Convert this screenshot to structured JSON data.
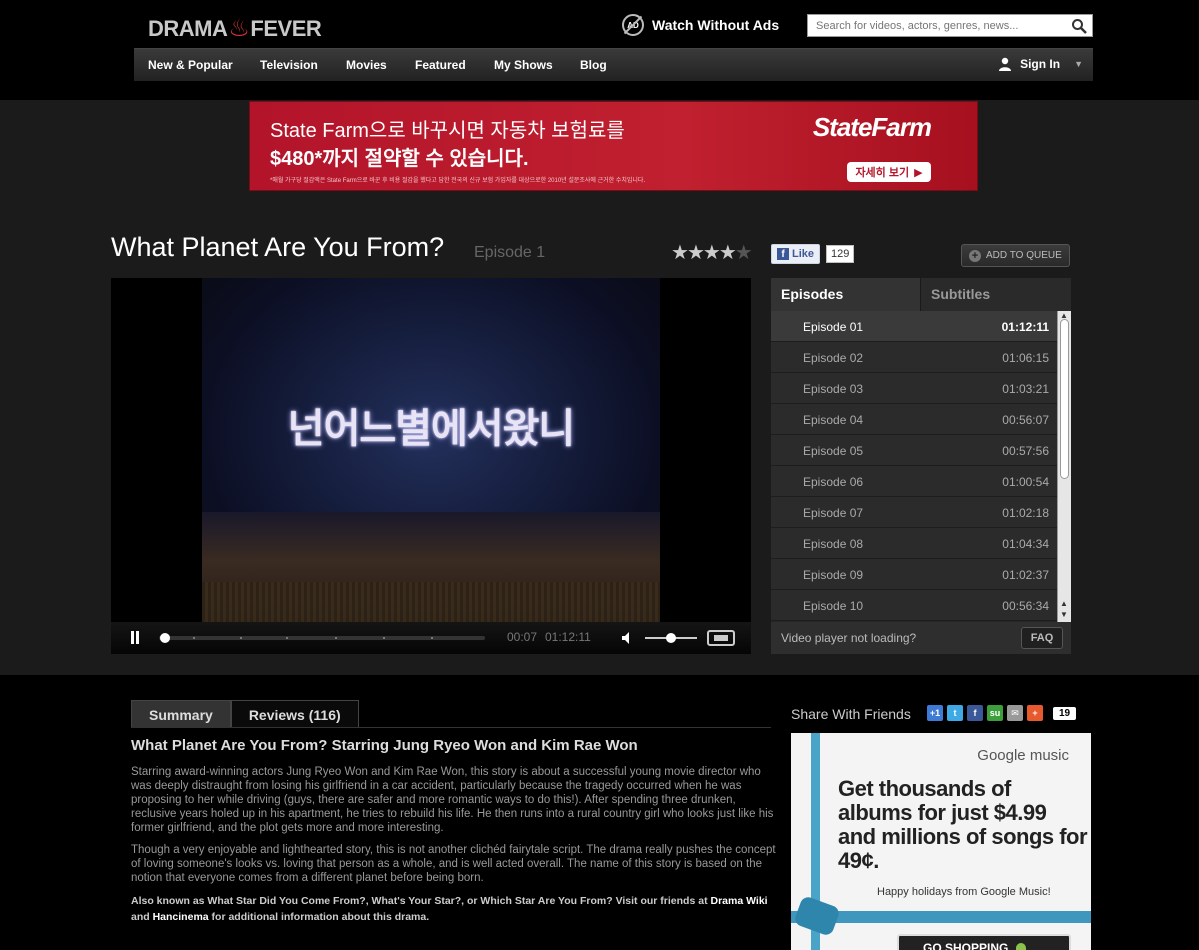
{
  "header": {
    "logo": {
      "left": "DRAMA",
      "right": "FEVER"
    },
    "adfree_icon_text": "AD",
    "adfree_label": "Watch Without Ads",
    "search_placeholder": "Search for videos, actors, genres, news..."
  },
  "nav": {
    "items": [
      "New & Popular",
      "Television",
      "Movies",
      "Featured",
      "My Shows",
      "Blog"
    ],
    "signin": "Sign In"
  },
  "banner_ad": {
    "line1": "State Farm으로 바꾸시면 자동차 보험료를",
    "line2": "$480*까지 절약할 수 있습니다.",
    "fine_print": "*매월 가구당 절감액은 State Farm으로 바꾼 후 비용 절감을 했다고 답한 전국의 신규 보험 가입자를 대상으로한 2010년 설문조사에 근거한 수치입니다.",
    "brand": "StateFarm",
    "cta": "자세히 보기"
  },
  "show": {
    "title": "What Planet Are You From?",
    "episode": "Episode 1",
    "rating": 4,
    "rating_max": 5,
    "fb_like": "Like",
    "fb_count": "129",
    "queue_label": "ADD TO QUEUE"
  },
  "player": {
    "caption": "넌어느별에서왔니",
    "current_time": "00:07",
    "total_time": "01:12:11",
    "progress": 0.0016,
    "volume": 0.5
  },
  "episodes_panel": {
    "tabs": [
      "Episodes",
      "Subtitles"
    ],
    "active_tab": "Episodes",
    "episodes": [
      {
        "name": "Episode 01",
        "duration": "01:12:11"
      },
      {
        "name": "Episode 02",
        "duration": "01:06:15"
      },
      {
        "name": "Episode 03",
        "duration": "01:03:21"
      },
      {
        "name": "Episode 04",
        "duration": "00:56:07"
      },
      {
        "name": "Episode 05",
        "duration": "00:57:56"
      },
      {
        "name": "Episode 06",
        "duration": "01:00:54"
      },
      {
        "name": "Episode 07",
        "duration": "01:02:18"
      },
      {
        "name": "Episode 08",
        "duration": "01:04:34"
      },
      {
        "name": "Episode 09",
        "duration": "01:02:37"
      },
      {
        "name": "Episode 10",
        "duration": "00:56:34"
      }
    ],
    "not_loading": "Video player not loading?",
    "faq": "FAQ"
  },
  "summary": {
    "tabs": [
      "Summary",
      "Reviews (116)"
    ],
    "heading": "What Planet Are You From? Starring Jung Ryeo Won and Kim Rae Won",
    "paragraph1": "Starring award-winning actors Jung Ryeo Won and Kim Rae Won, this story is about a successful young movie director who was deeply distraught from losing his girlfriend in a car accident, particularly because the tragedy occurred when he was proposing to her while driving (guys, there are safer and more romantic ways to do this!). After spending three drunken, reclusive years holed up in his apartment, he tries to rebuild his life. He then runs into a rural country girl who looks just like his former girlfriend, and the plot gets more and more interesting.",
    "paragraph2": "Though a very enjoyable and lighthearted story, this is not another clichéd fairytale script. The drama really pushes the concept of loving someone's looks vs. loving that person as a whole, and is well acted overall. The name of this story is based on the notion that everyone comes from a different planet before being born.",
    "aka_pre": "Also known as What Star Did You Come From?, What's Your Star?, or Which Star Are You From? Visit our friends at",
    "link1": "Drama Wiki",
    "and": "and",
    "link2": "Hancinema",
    "aka_post": "for additional information about this drama."
  },
  "share": {
    "heading": "Share With Friends",
    "icons": [
      {
        "name": "google-plus-icon",
        "text": "+1",
        "color": "#3d7bd4"
      },
      {
        "name": "twitter-icon",
        "text": "t",
        "color": "#3fa9e6"
      },
      {
        "name": "facebook-icon",
        "text": "f",
        "color": "#3b5998"
      },
      {
        "name": "stumbleupon-icon",
        "text": "su",
        "color": "#3c9f3c"
      },
      {
        "name": "email-icon",
        "text": "✉",
        "color": "#999999"
      },
      {
        "name": "addthis-icon",
        "text": "+",
        "color": "#e8592d"
      }
    ],
    "count": "19"
  },
  "google_ad": {
    "logo": "Google music",
    "headline": "Get thousands of albums for just $4.99 and millions of songs for 49¢.",
    "sub": "Happy holidays from Google Music!",
    "cta": "GO SHOPPING"
  }
}
